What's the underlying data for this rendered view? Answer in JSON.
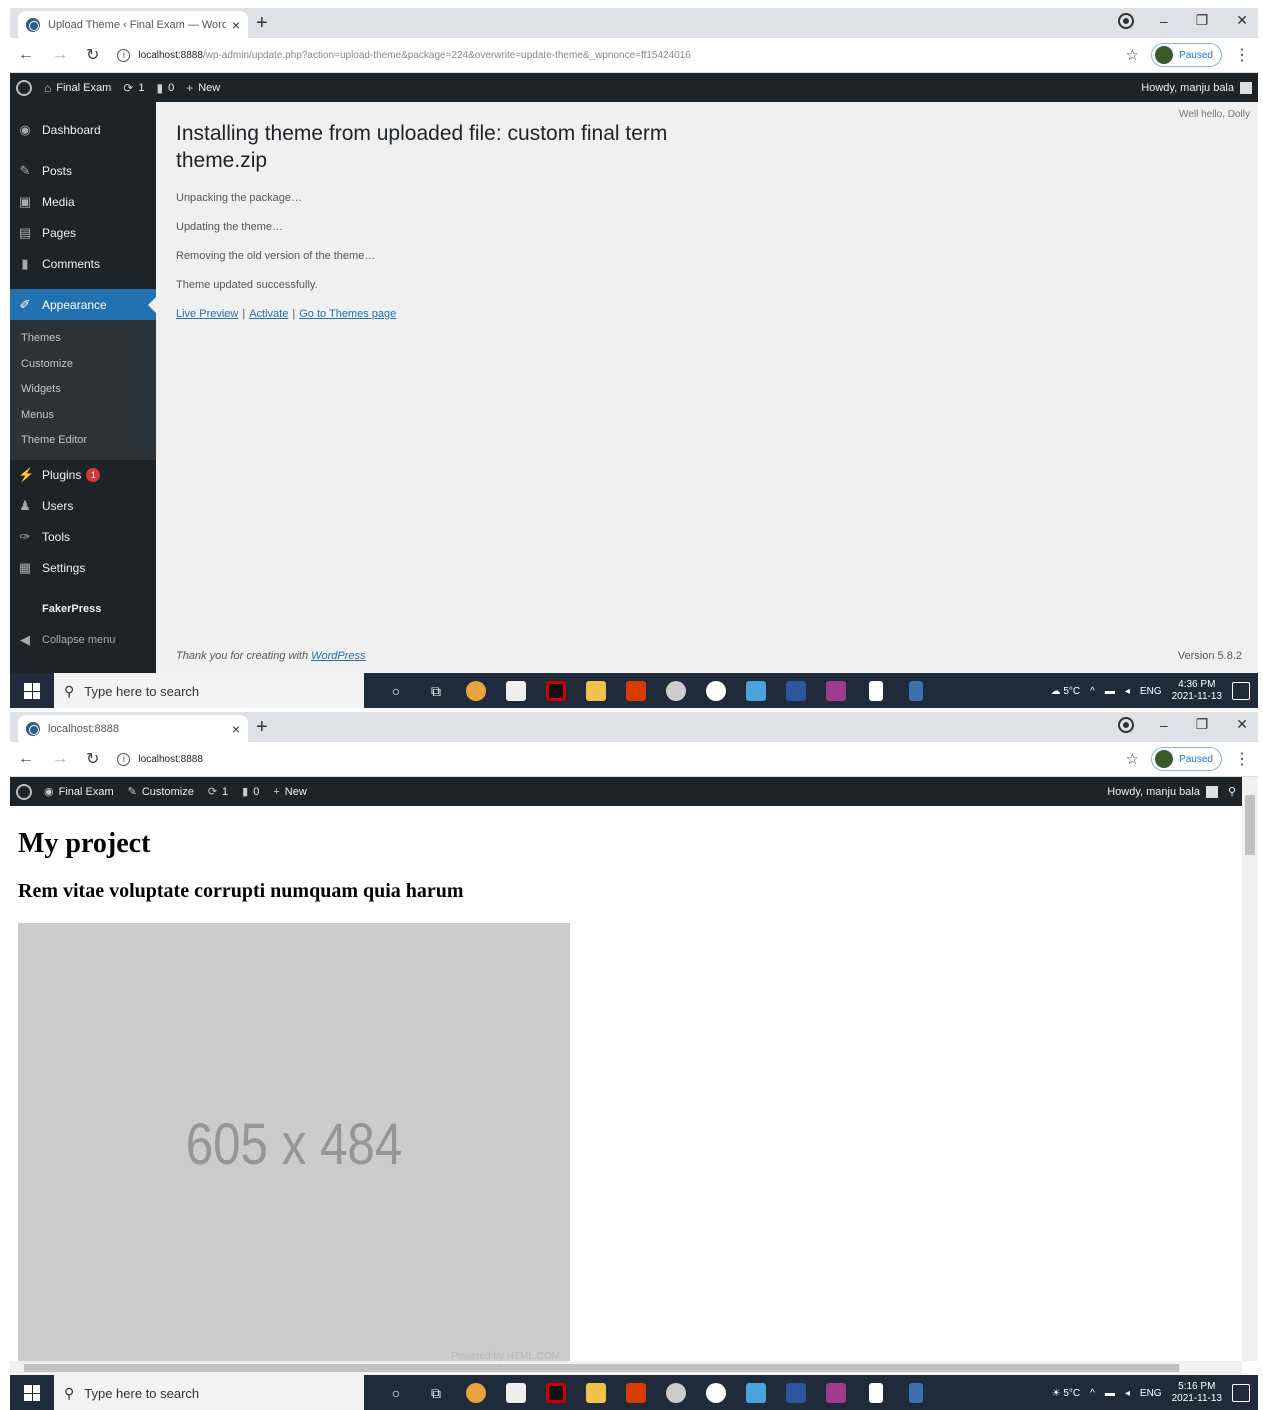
{
  "top": {
    "tab_title": "Upload Theme ‹ Final Exam — WordPress",
    "url_host": "localhost:8888",
    "url_path": "/wp-admin/update.php?action=upload-theme&package=224&overwrite=update-theme&_wpnonce=ff15424016",
    "profile_label": "Paused",
    "adminbar": {
      "site": "Final Exam",
      "updates": "1",
      "comments": "0",
      "new": "New",
      "howdy": "Howdy, manju bala"
    },
    "sidebar": {
      "items": [
        "Dashboard",
        "Posts",
        "Media",
        "Pages",
        "Comments",
        "Appearance"
      ],
      "submenu": [
        "Themes",
        "Customize",
        "Widgets",
        "Menus",
        "Theme Editor"
      ],
      "items2": [
        "Plugins",
        "Users",
        "Tools",
        "Settings"
      ],
      "plugins_badge": "1",
      "fakerpress": "FakerPress",
      "collapse": "Collapse menu"
    },
    "content": {
      "help": "Well hello, Dolly",
      "heading": "Installing theme from uploaded file: custom final term theme.zip",
      "steps": [
        "Unpacking the package…",
        "Updating the theme…",
        "Removing the old version of the theme…",
        "Theme updated successfully."
      ],
      "links": [
        "Live Preview",
        "Activate",
        "Go to Themes page"
      ],
      "footer_text": "Thank you for creating with ",
      "footer_link": "WordPress",
      "version": "Version 5.8.2"
    },
    "taskbar": {
      "search_placeholder": "Type here to search",
      "weather": "5°C",
      "lang": "ENG",
      "time": "4:36 PM",
      "date": "2021-11-13"
    }
  },
  "bottom": {
    "tab_title": "localhost:8888",
    "url_host": "localhost:8888",
    "profile_label": "Paused",
    "adminbar": {
      "site": "Final Exam",
      "customize": "Customize",
      "updates": "1",
      "comments": "0",
      "new": "New",
      "howdy": "Howdy, manju bala"
    },
    "page": {
      "title": "My project",
      "subtitle": "Rem vitae voluptate corrupti numquam quia harum",
      "image_text": "605 x 484",
      "image_credit": "Powered by HTML.COM"
    },
    "taskbar": {
      "search_placeholder": "Type here to search",
      "weather": "5°C",
      "lang": "ENG",
      "time": "5:16 PM",
      "date": "2021-11-13"
    }
  }
}
